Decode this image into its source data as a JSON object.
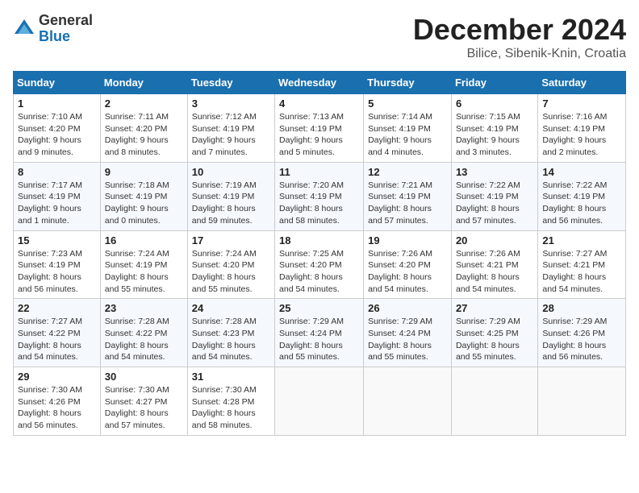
{
  "logo": {
    "general": "General",
    "blue": "Blue"
  },
  "header": {
    "month": "December 2024",
    "location": "Bilice, Sibenik-Knin, Croatia"
  },
  "weekdays": [
    "Sunday",
    "Monday",
    "Tuesday",
    "Wednesday",
    "Thursday",
    "Friday",
    "Saturday"
  ],
  "weeks": [
    [
      {
        "day": "1",
        "sunrise": "7:10 AM",
        "sunset": "4:20 PM",
        "daylight": "9 hours and 9 minutes."
      },
      {
        "day": "2",
        "sunrise": "7:11 AM",
        "sunset": "4:20 PM",
        "daylight": "9 hours and 8 minutes."
      },
      {
        "day": "3",
        "sunrise": "7:12 AM",
        "sunset": "4:19 PM",
        "daylight": "9 hours and 7 minutes."
      },
      {
        "day": "4",
        "sunrise": "7:13 AM",
        "sunset": "4:19 PM",
        "daylight": "9 hours and 5 minutes."
      },
      {
        "day": "5",
        "sunrise": "7:14 AM",
        "sunset": "4:19 PM",
        "daylight": "9 hours and 4 minutes."
      },
      {
        "day": "6",
        "sunrise": "7:15 AM",
        "sunset": "4:19 PM",
        "daylight": "9 hours and 3 minutes."
      },
      {
        "day": "7",
        "sunrise": "7:16 AM",
        "sunset": "4:19 PM",
        "daylight": "9 hours and 2 minutes."
      }
    ],
    [
      {
        "day": "8",
        "sunrise": "7:17 AM",
        "sunset": "4:19 PM",
        "daylight": "9 hours and 1 minute."
      },
      {
        "day": "9",
        "sunrise": "7:18 AM",
        "sunset": "4:19 PM",
        "daylight": "9 hours and 0 minutes."
      },
      {
        "day": "10",
        "sunrise": "7:19 AM",
        "sunset": "4:19 PM",
        "daylight": "8 hours and 59 minutes."
      },
      {
        "day": "11",
        "sunrise": "7:20 AM",
        "sunset": "4:19 PM",
        "daylight": "8 hours and 58 minutes."
      },
      {
        "day": "12",
        "sunrise": "7:21 AM",
        "sunset": "4:19 PM",
        "daylight": "8 hours and 57 minutes."
      },
      {
        "day": "13",
        "sunrise": "7:22 AM",
        "sunset": "4:19 PM",
        "daylight": "8 hours and 57 minutes."
      },
      {
        "day": "14",
        "sunrise": "7:22 AM",
        "sunset": "4:19 PM",
        "daylight": "8 hours and 56 minutes."
      }
    ],
    [
      {
        "day": "15",
        "sunrise": "7:23 AM",
        "sunset": "4:19 PM",
        "daylight": "8 hours and 56 minutes."
      },
      {
        "day": "16",
        "sunrise": "7:24 AM",
        "sunset": "4:19 PM",
        "daylight": "8 hours and 55 minutes."
      },
      {
        "day": "17",
        "sunrise": "7:24 AM",
        "sunset": "4:20 PM",
        "daylight": "8 hours and 55 minutes."
      },
      {
        "day": "18",
        "sunrise": "7:25 AM",
        "sunset": "4:20 PM",
        "daylight": "8 hours and 54 minutes."
      },
      {
        "day": "19",
        "sunrise": "7:26 AM",
        "sunset": "4:20 PM",
        "daylight": "8 hours and 54 minutes."
      },
      {
        "day": "20",
        "sunrise": "7:26 AM",
        "sunset": "4:21 PM",
        "daylight": "8 hours and 54 minutes."
      },
      {
        "day": "21",
        "sunrise": "7:27 AM",
        "sunset": "4:21 PM",
        "daylight": "8 hours and 54 minutes."
      }
    ],
    [
      {
        "day": "22",
        "sunrise": "7:27 AM",
        "sunset": "4:22 PM",
        "daylight": "8 hours and 54 minutes."
      },
      {
        "day": "23",
        "sunrise": "7:28 AM",
        "sunset": "4:22 PM",
        "daylight": "8 hours and 54 minutes."
      },
      {
        "day": "24",
        "sunrise": "7:28 AM",
        "sunset": "4:23 PM",
        "daylight": "8 hours and 54 minutes."
      },
      {
        "day": "25",
        "sunrise": "7:29 AM",
        "sunset": "4:24 PM",
        "daylight": "8 hours and 55 minutes."
      },
      {
        "day": "26",
        "sunrise": "7:29 AM",
        "sunset": "4:24 PM",
        "daylight": "8 hours and 55 minutes."
      },
      {
        "day": "27",
        "sunrise": "7:29 AM",
        "sunset": "4:25 PM",
        "daylight": "8 hours and 55 minutes."
      },
      {
        "day": "28",
        "sunrise": "7:29 AM",
        "sunset": "4:26 PM",
        "daylight": "8 hours and 56 minutes."
      }
    ],
    [
      {
        "day": "29",
        "sunrise": "7:30 AM",
        "sunset": "4:26 PM",
        "daylight": "8 hours and 56 minutes."
      },
      {
        "day": "30",
        "sunrise": "7:30 AM",
        "sunset": "4:27 PM",
        "daylight": "8 hours and 57 minutes."
      },
      {
        "day": "31",
        "sunrise": "7:30 AM",
        "sunset": "4:28 PM",
        "daylight": "8 hours and 58 minutes."
      },
      null,
      null,
      null,
      null
    ]
  ]
}
